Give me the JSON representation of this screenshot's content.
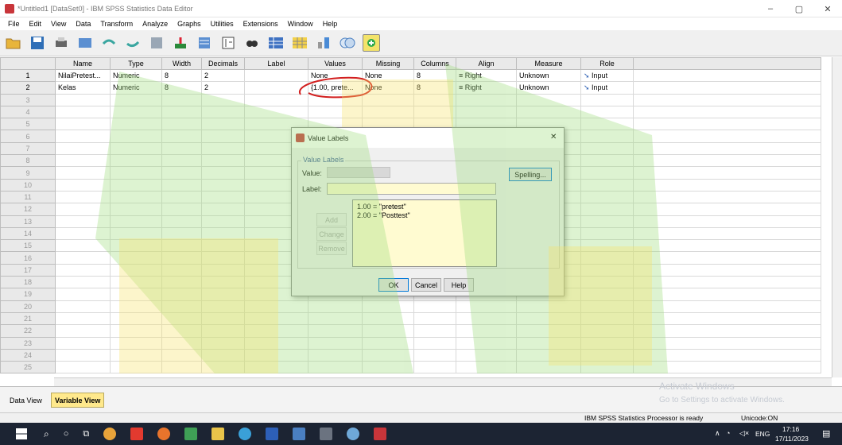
{
  "window": {
    "title": "*Untitled1 [DataSet0] - IBM SPSS Statistics Data Editor",
    "min": "–",
    "max": "▢",
    "close": "✕"
  },
  "menu": [
    "File",
    "Edit",
    "View",
    "Data",
    "Transform",
    "Analyze",
    "Graphs",
    "Utilities",
    "Extensions",
    "Window",
    "Help"
  ],
  "grid": {
    "columns": [
      "Name",
      "Type",
      "Width",
      "Decimals",
      "Label",
      "Values",
      "Missing",
      "Columns",
      "Align",
      "Measure",
      "Role"
    ],
    "rows": [
      {
        "n": "1",
        "name": "NilaiPretest...",
        "type": "Numeric",
        "width": "8",
        "decimals": "2",
        "label": "",
        "values": "None",
        "missing": "None",
        "columns": "8",
        "align": "Right",
        "measure": "Unknown",
        "role": "Input"
      },
      {
        "n": "2",
        "name": "Kelas",
        "type": "Numeric",
        "width": "8",
        "decimals": "2",
        "label": "",
        "values": "{1.00, prete...",
        "missing": "None",
        "columns": "8",
        "align": "Right",
        "measure": "Unknown",
        "role": "Input"
      }
    ],
    "empty_rows": [
      "3",
      "4",
      "5",
      "6",
      "7",
      "8",
      "9",
      "10",
      "11",
      "12",
      "13",
      "14",
      "15",
      "16",
      "17",
      "18",
      "19",
      "20",
      "21",
      "22",
      "23",
      "24",
      "25"
    ]
  },
  "dialog": {
    "title": "Value Labels",
    "group_label": "Value Labels",
    "value_label": "Value:",
    "label_label": "Label:",
    "spelling": "Spelling...",
    "add": "Add",
    "change": "Change",
    "remove": "Remove",
    "list": [
      "1.00 = \"pretest\"",
      "2.00 = \"Posttest\""
    ],
    "ok": "OK",
    "cancel": "Cancel",
    "help": "Help",
    "close": "✕"
  },
  "tabs": {
    "data_view": "Data View",
    "variable_view": "Variable View"
  },
  "activate": {
    "line1": "Activate Windows",
    "line2": "Go to Settings to activate Windows."
  },
  "status": {
    "processor": "IBM SPSS Statistics Processor is ready",
    "unicode": "Unicode:ON"
  },
  "taskbar": {
    "lang": "ENG",
    "time": "17:16",
    "date": "17/11/2023"
  }
}
